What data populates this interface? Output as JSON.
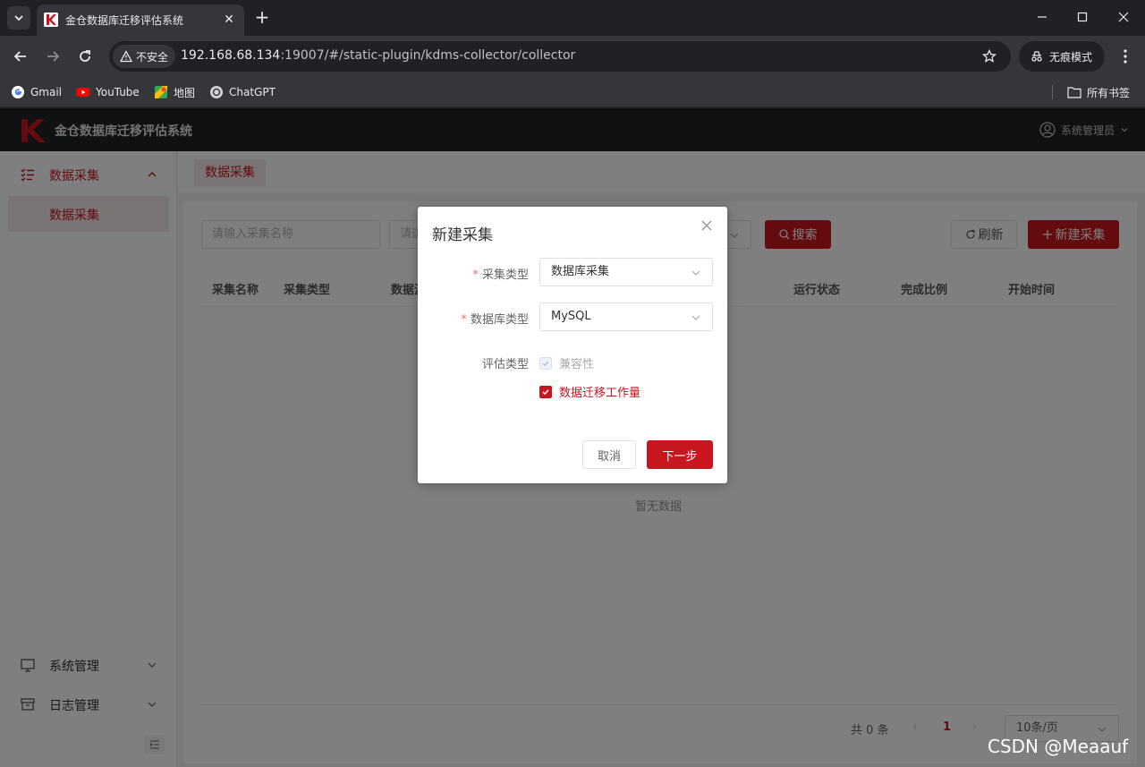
{
  "browser": {
    "tab_title": "金仓数据库迁移评估系统",
    "security_label": "不安全",
    "url_host": "192.168.68.134",
    "url_rest": ":19007/#/static-plugin/kdms-collector/collector",
    "incognito_label": "无痕模式",
    "bookmarks": [
      "Gmail",
      "YouTube",
      "地图",
      "ChatGPT"
    ],
    "all_bookmarks": "所有书签"
  },
  "app": {
    "title": "金仓数据库迁移评估系统",
    "user": "系统管理员",
    "brand_color": "#c8161e"
  },
  "sidebar": {
    "group_data": "数据采集",
    "sub_data": "数据采集",
    "group_system": "系统管理",
    "group_log": "日志管理"
  },
  "breadcrumb": "数据采集",
  "toolbar": {
    "name_placeholder": "请输入采集名称",
    "second_placeholder": "请选",
    "search": "搜索",
    "refresh": "刷新",
    "new": "新建采集"
  },
  "table": {
    "columns": [
      "采集名称",
      "采集类型",
      "数据源",
      "运行状态",
      "完成比例",
      "开始时间"
    ],
    "empty_text": "暂无数据"
  },
  "pagination": {
    "total": "共 0 条",
    "current_page": "1",
    "page_size": "10条/页"
  },
  "dialog": {
    "title": "新建采集",
    "collect_type_label": "采集类型",
    "collect_type_value": "数据库采集",
    "db_type_label": "数据库类型",
    "db_type_value": "MySQL",
    "eval_type_label": "评估类型",
    "opt_compat": "兼容性",
    "opt_workload": "数据迁移工作量",
    "cancel": "取消",
    "next": "下一步"
  },
  "watermark": "CSDN @Meaauf"
}
